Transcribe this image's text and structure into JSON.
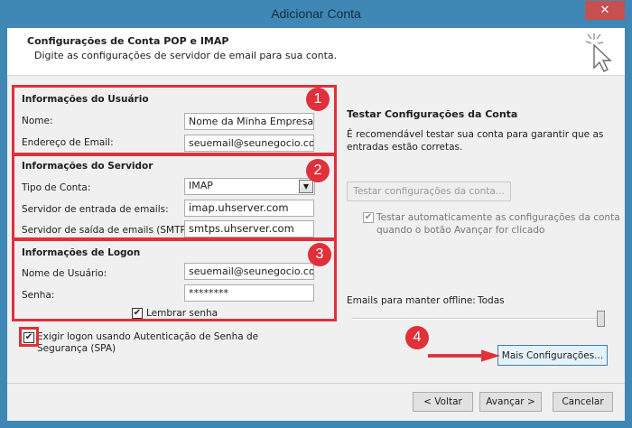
{
  "window": {
    "title": "Adicionar Conta",
    "close_glyph": "✕"
  },
  "header": {
    "title": "Configurações de Conta POP e IMAP",
    "subtitle": "Digite as configurações de servidor de email para sua conta."
  },
  "user_info": {
    "section": "Informações do Usuário",
    "name_label": "Nome:",
    "name_value": "Nome da Minha Empresa",
    "email_label": "Endereço de Email:",
    "email_value": "seuemail@seunegocio.com"
  },
  "server_info": {
    "section": "Informações do Servidor",
    "type_label": "Tipo de Conta:",
    "type_value": "IMAP",
    "incoming_label": "Servidor de entrada de emails:",
    "incoming_value": "imap.uhserver.com",
    "outgoing_label": "Servidor de saída de emails (SMTP):",
    "outgoing_value": "smtps.uhserver.com"
  },
  "logon_info": {
    "section": "Informações de Logon",
    "username_label": "Nome de Usuário:",
    "username_value": "seuemail@seunegocio.com",
    "password_label": "Senha:",
    "password_value": "********",
    "remember_label": "Lembrar senha",
    "remember_checked": true
  },
  "spa": {
    "label": "Exigir logon usando Autenticação de Senha de Segurança (SPA)",
    "checked": true
  },
  "test_panel": {
    "title": "Testar Configurações da Conta",
    "description": "É recomendável testar sua conta para garantir que as entradas estão corretas.",
    "test_button": "Testar configurações da conta...",
    "auto_test_label": "Testar automaticamente as configurações da conta quando o botão Avançar for clicado",
    "offline_label": "Emails para manter offline:",
    "offline_value": "Todas",
    "offline_level": 1.0
  },
  "more_settings_button": "Mais Configurações...",
  "footer": {
    "back": "< Voltar",
    "next": "Avançar >",
    "cancel": "Cancelar"
  },
  "annotations": {
    "b1": "1",
    "b2": "2",
    "b3": "3",
    "b4": "4"
  },
  "colors": {
    "titlebar": "#3f88b5",
    "annotation": "#e0303a",
    "close": "#c75050"
  }
}
